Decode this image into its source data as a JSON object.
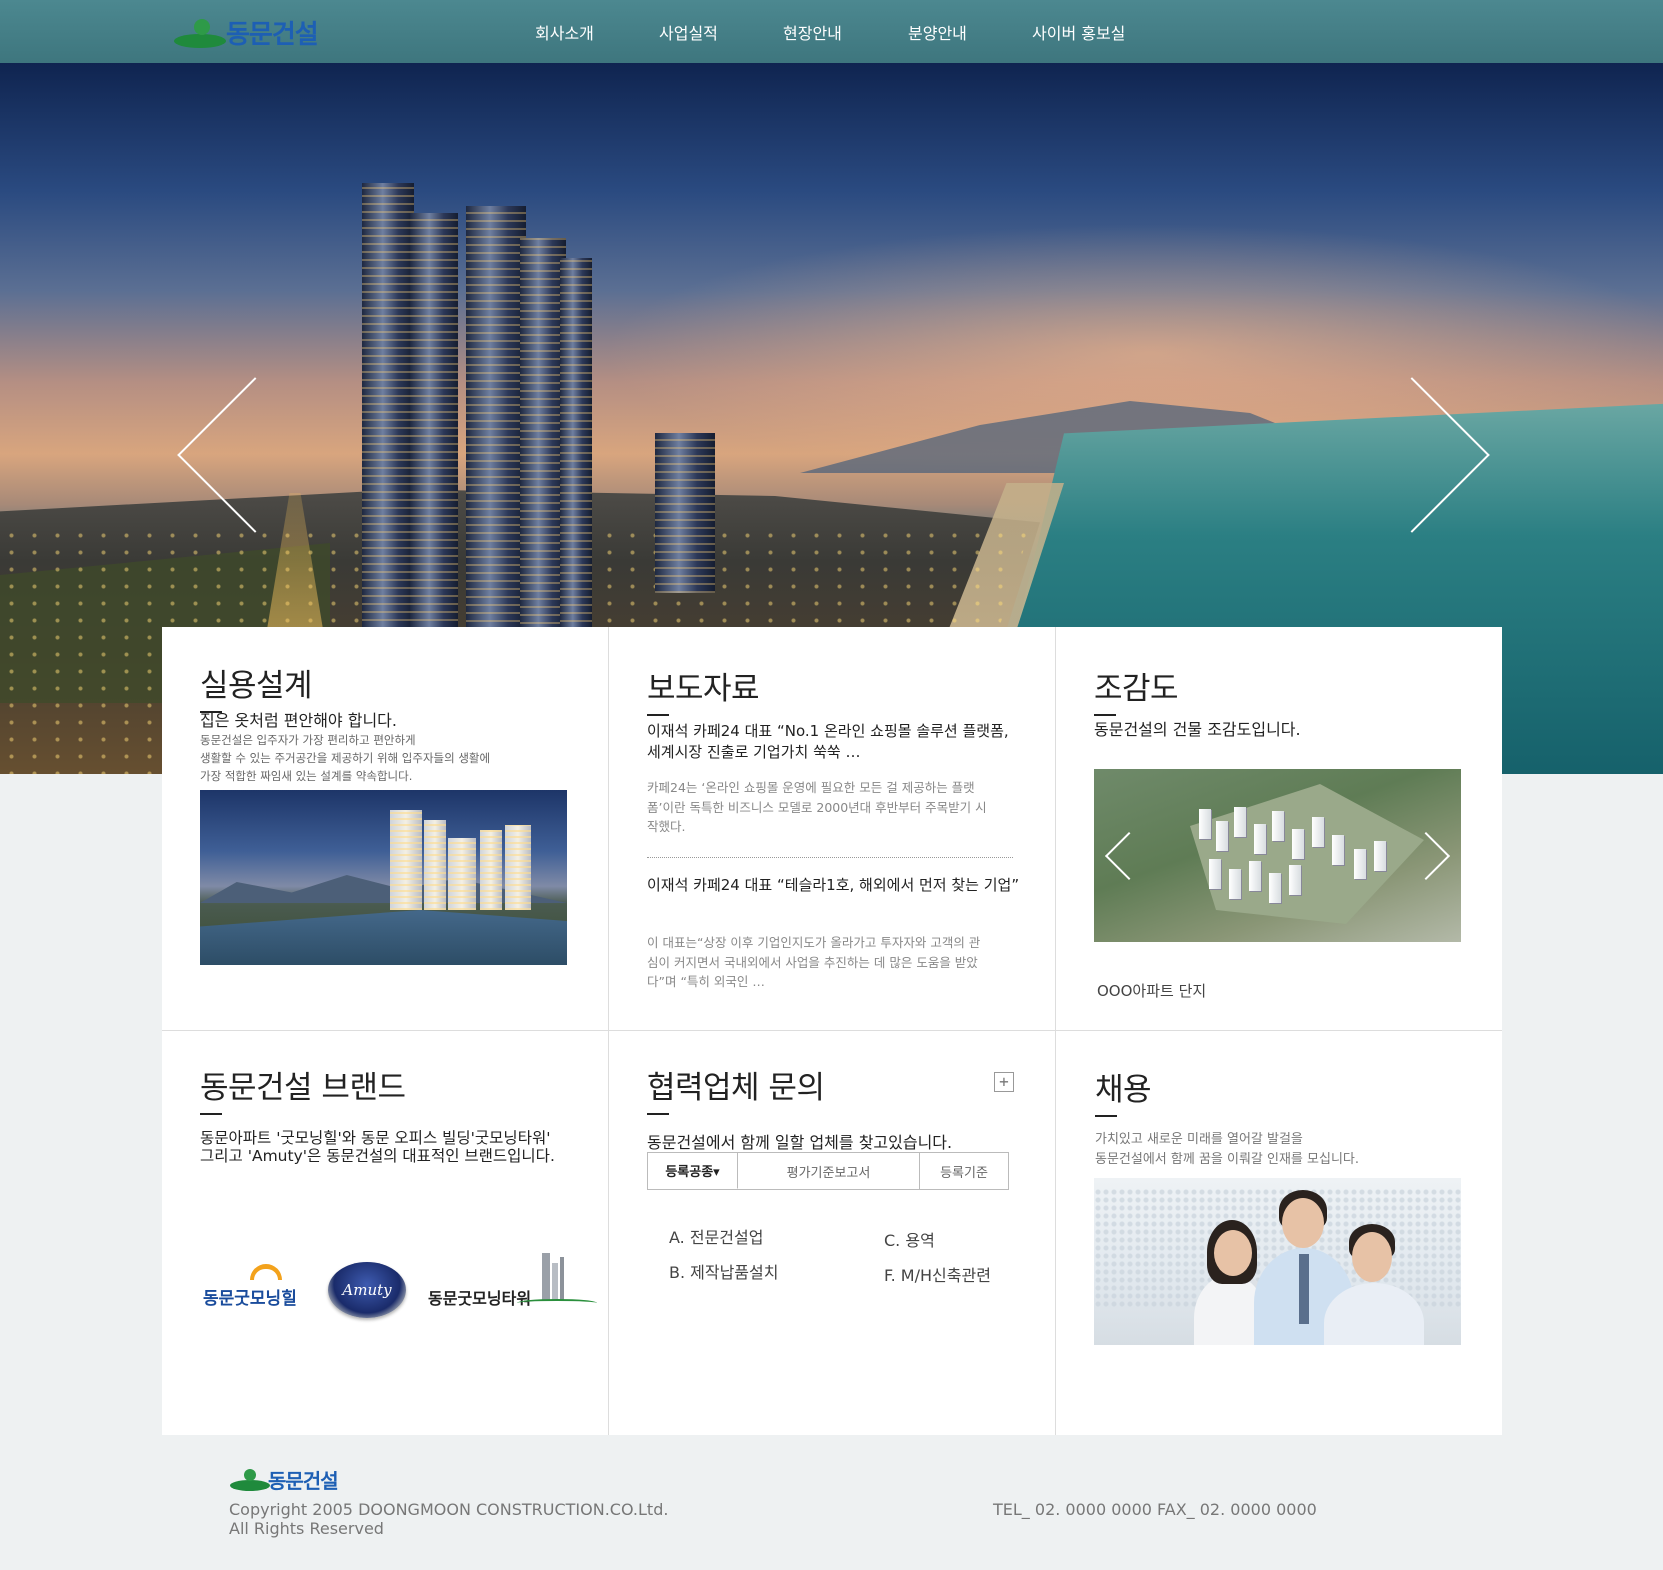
{
  "header": {
    "logo_text": "동문건설",
    "nav": [
      "회사소개",
      "사업실적",
      "현장안내",
      "분양안내",
      "사이버 홍보실"
    ]
  },
  "panels": {
    "design": {
      "title": "실용설계",
      "subtitle": "집은 옷처럼 편안해야 합니다.",
      "desc_lines": [
        "동문건설은 입주자가 가장 편리하고 편안하게",
        "생활할 수 있는 주거공간을 제공하기 위해 입주자들의 생활에",
        "가장 적합한 짜임새 있는 설계를 약속합니다."
      ]
    },
    "press": {
      "title": "보도자료",
      "item1_title_lines": [
        "이재석 카페24 대표 “No.1 온라인 쇼핑몰 솔루션 플랫폼,",
        "세계시장 진출로 기업가치 쑥쑥 …"
      ],
      "item1_body_lines": [
        "카페24는 ‘온라인 쇼핑몰 운영에 필요한 모든 걸 제공하는 플랫",
        "폼’이란 독특한 비즈니스 모델로 2000년대 후반부터 주목받기 시",
        "작했다."
      ],
      "item2_title": "이재석 카페24 대표 “테슬라1호, 해외에서 먼저 찾는 기업”",
      "item2_body_lines": [
        "이 대표는“상장 이후 기업인지도가 올라가고 투자자와 고객의 관",
        "심이 커지면서 국내외에서 사업을 추진하는 데 많은 도움을 받았",
        "다”며 “특히 외국인 …"
      ]
    },
    "birdseye": {
      "title": "조감도",
      "subtitle": "동문건설의 건물 조감도입니다.",
      "caption": "OOO아파트 단지"
    },
    "brand": {
      "title": "동문건설 브랜드",
      "desc_lines": [
        "동문아파트 '굿모닝힐'와  동문 오피스 빌딩'굿모닝타워'",
        "그리고 'Amuty'은 동문건설의 대표적인 브랜드입니다."
      ],
      "logo1": "동문굿모닝힐",
      "logo2": "Amuty",
      "logo3": "동문굿모닝타워"
    },
    "partner": {
      "title": "협력업체 문의",
      "plus": "+",
      "subtitle": "동문건설에서 함께 일할 업체를 찾고있습니다.",
      "tabs": [
        "등록공종▾",
        "평가기준보고서",
        "등록기준"
      ],
      "categories": [
        "A. 전문건설업",
        "C. 용역",
        "B. 제작납품설치",
        "F. M/H신축관련"
      ]
    },
    "recruit": {
      "title": "채용",
      "desc_lines": [
        "가치있고 새로운 미래를 열어갈 발걸을",
        "동문건설에서 함께 꿈을 이뤄갈 인재를 모십니다."
      ]
    }
  },
  "footer": {
    "logo_text": "동문건설",
    "copyright_lines": [
      "Copyright 2005 DOONGMOON CONSTRUCTION.CO.Ltd.",
      "All Rights Reserved"
    ],
    "contact": "TEL_ 02. 0000 0000   FAX_ 02. 0000 0000"
  },
  "colors": {
    "header_bg": "#427d85",
    "logo_blue": "#1d5fb4",
    "logo_green": "#1f8a3c",
    "page_bg": "#eef1f2"
  },
  "icons": [
    "prev-arrow-icon",
    "next-arrow-icon",
    "plus-icon",
    "logo-mark-icon"
  ]
}
